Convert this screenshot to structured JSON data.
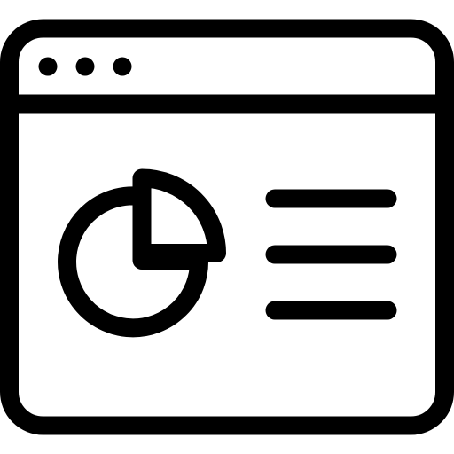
{
  "icon": {
    "name": "browser-window-analytics-icon",
    "stroke_color": "#000000",
    "background_color": "#ffffff",
    "window_control_dots": 3,
    "text_lines": 3,
    "pie_chart": {
      "highlighted_slice_fraction": 0.25
    }
  }
}
